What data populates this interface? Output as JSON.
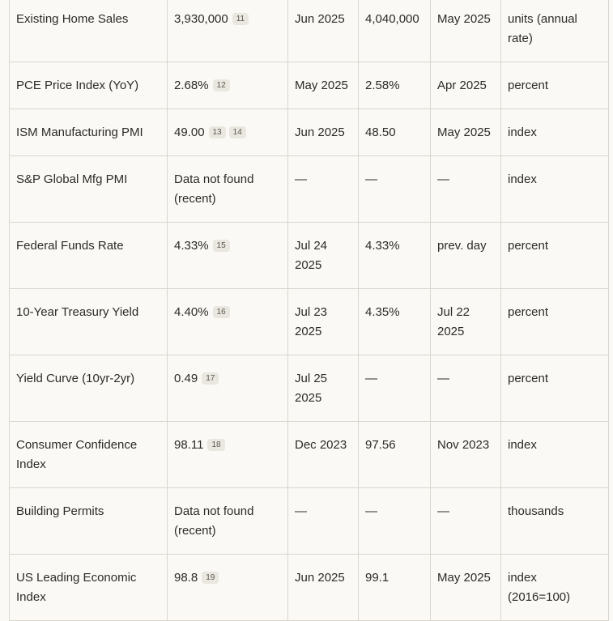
{
  "rows": [
    {
      "indicator": "Existing Home Sales",
      "latest": "3,930,000",
      "cites": [
        "11"
      ],
      "latest_date": "Jun 2025",
      "previous": "4,040,000",
      "prev_date": "May 2025",
      "unit": "units (annual rate)"
    },
    {
      "indicator": "PCE Price Index (YoY)",
      "latest": "2.68%",
      "cites": [
        "12"
      ],
      "latest_date": "May 2025",
      "previous": "2.58%",
      "prev_date": "Apr 2025",
      "unit": "percent"
    },
    {
      "indicator": "ISM Manufacturing PMI",
      "latest": "49.00",
      "cites": [
        "13",
        "14"
      ],
      "latest_date": "Jun 2025",
      "previous": "48.50",
      "prev_date": "May 2025",
      "unit": "index"
    },
    {
      "indicator": "S&P Global Mfg PMI",
      "latest": "Data not found (recent)",
      "cites": [],
      "latest_date": "—",
      "previous": "—",
      "prev_date": "—",
      "unit": "index"
    },
    {
      "indicator": "Federal Funds Rate",
      "latest": "4.33%",
      "cites": [
        "15"
      ],
      "latest_date": "Jul 24 2025",
      "previous": "4.33%",
      "prev_date": "prev. day",
      "unit": "percent"
    },
    {
      "indicator": "10-Year Treasury Yield",
      "latest": "4.40%",
      "cites": [
        "16"
      ],
      "latest_date": "Jul 23 2025",
      "previous": "4.35%",
      "prev_date": "Jul 22 2025",
      "unit": "percent"
    },
    {
      "indicator": "Yield Curve (10yr-2yr)",
      "latest": "0.49",
      "cites": [
        "17"
      ],
      "latest_date": "Jul 25 2025",
      "previous": "—",
      "prev_date": "—",
      "unit": "percent"
    },
    {
      "indicator": "Consumer Confidence Index",
      "latest": "98.11",
      "cites": [
        "18"
      ],
      "latest_date": "Dec 2023",
      "previous": "97.56",
      "prev_date": "Nov 2023",
      "unit": "index"
    },
    {
      "indicator": "Building Permits",
      "latest": "Data not found (recent)",
      "cites": [],
      "latest_date": "—",
      "previous": "—",
      "prev_date": "—",
      "unit": "thousands"
    },
    {
      "indicator": "US Leading Economic Index",
      "latest": "98.8",
      "cites": [
        "19"
      ],
      "latest_date": "Jun 2025",
      "previous": "99.1",
      "prev_date": "May 2025",
      "unit": "index (2016=100)"
    }
  ]
}
